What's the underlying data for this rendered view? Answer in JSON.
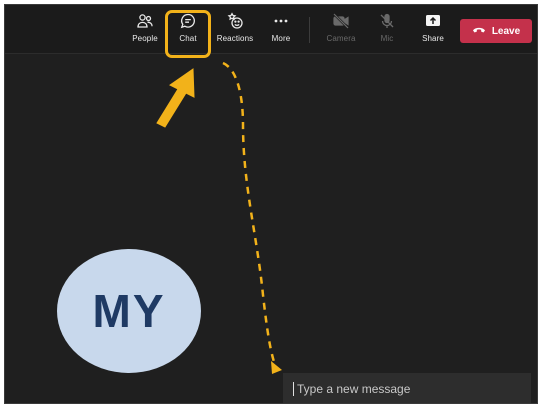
{
  "toolbar": {
    "items": [
      {
        "label": "People",
        "icon": "people-icon"
      },
      {
        "label": "Chat",
        "icon": "chat-icon"
      },
      {
        "label": "Reactions",
        "icon": "reactions-icon"
      },
      {
        "label": "More",
        "icon": "more-icon"
      },
      {
        "label": "Camera",
        "icon": "camera-off-icon"
      },
      {
        "label": "Mic",
        "icon": "mic-off-icon"
      },
      {
        "label": "Share",
        "icon": "share-icon"
      }
    ],
    "leave_label": "Leave"
  },
  "participant": {
    "initials": "MY"
  },
  "chat": {
    "placeholder": "Type a new message"
  },
  "colors": {
    "highlight": "#f2b21a",
    "leave": "#c4314b",
    "avatar_bg": "#c8d8ec",
    "avatar_text": "#1f3a64",
    "input_underline": "#7f85f5"
  }
}
